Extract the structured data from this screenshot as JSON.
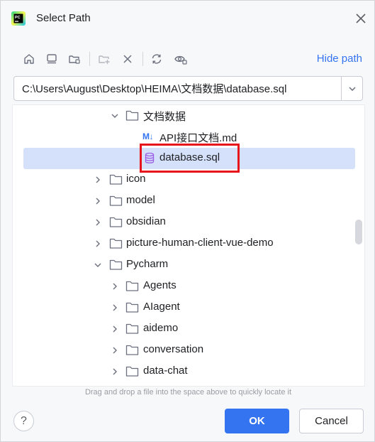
{
  "window": {
    "title": "Select Path",
    "app_icon": "pycharm-logo-icon",
    "app_icon_text": "PC"
  },
  "toolbar": {
    "buttons": [
      {
        "name": "home-icon",
        "enabled": true
      },
      {
        "name": "desktop-icon",
        "enabled": true
      },
      {
        "name": "project-folder-icon",
        "enabled": true
      },
      {
        "name": "new-folder-icon",
        "enabled": false
      },
      {
        "name": "delete-icon",
        "enabled": true
      },
      {
        "name": "refresh-icon",
        "enabled": true
      },
      {
        "name": "show-hidden-icon",
        "enabled": true
      }
    ],
    "hide_path_label": "Hide path"
  },
  "path_field": {
    "value": "C:\\Users\\August\\Desktop\\HEIMA\\文档数据\\database.sql"
  },
  "tree": {
    "items": [
      {
        "label": "文档数据",
        "type": "folder",
        "expanded": true
      },
      {
        "label": "API接口文档.md",
        "type": "markdown",
        "badge": "M↓"
      },
      {
        "label": "database.sql",
        "type": "database",
        "selected": true
      },
      {
        "label": "icon",
        "type": "folder",
        "expanded": false
      },
      {
        "label": "model",
        "type": "folder",
        "expanded": false
      },
      {
        "label": "obsidian",
        "type": "folder",
        "expanded": false
      },
      {
        "label": "picture-human-client-vue-demo",
        "type": "folder",
        "expanded": false
      },
      {
        "label": "Pycharm",
        "type": "folder",
        "expanded": true
      },
      {
        "label": "Agents",
        "type": "folder",
        "expanded": false
      },
      {
        "label": "AIagent",
        "type": "folder",
        "expanded": false
      },
      {
        "label": "aidemo",
        "type": "folder",
        "expanded": false
      },
      {
        "label": "conversation",
        "type": "folder",
        "expanded": false
      },
      {
        "label": "data-chat",
        "type": "folder",
        "expanded": false
      }
    ]
  },
  "hint": "Drag and drop a file into the space above to quickly locate it",
  "buttons": {
    "help": "?",
    "ok": "OK",
    "cancel": "Cancel"
  },
  "colors": {
    "accent": "#3574f0",
    "selection": "#d5e1fb",
    "highlight_box": "#e8141b",
    "database_icon": "#9b5de5"
  }
}
